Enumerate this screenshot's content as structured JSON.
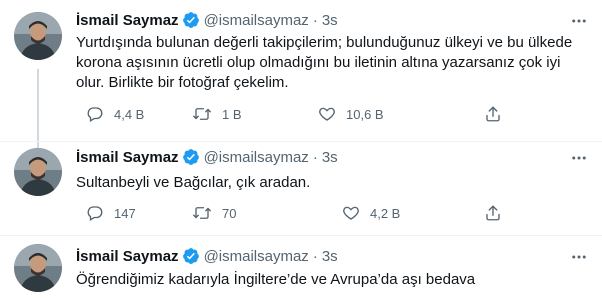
{
  "tweets": [
    {
      "name": "İsmail Saymaz",
      "handle": "@ismailsaymaz",
      "time": "3s",
      "text": "Yurtdışında bulunan değerli takipçilerim; bulunduğunuz ülkeyi ve bu ülkede korona aşısının ücretli olup olmadığını bu iletinin altına yazarsanız çok iyi olur. Birlikte bir fotoğraf çekelim.",
      "replies": "4,4 B",
      "retweets": "1 B",
      "likes": "10,6 B"
    },
    {
      "name": "İsmail Saymaz",
      "handle": "@ismailsaymaz",
      "time": "3s",
      "text": "Sultanbeyli ve Bağcılar, çık aradan.",
      "replies": "147",
      "retweets": "70",
      "likes": "4,2 B"
    },
    {
      "name": "İsmail Saymaz",
      "handle": "@ismailsaymaz",
      "time": "3s",
      "text": "Öğrendiğimiz kadarıyla İngiltere’de ve Avrupa’da aşı bedava"
    }
  ],
  "colors": {
    "text": "#0f1419",
    "secondary": "#536471",
    "verified": "#1d9bf0",
    "divider": "#eff3f4",
    "thread_line": "#cfd9de"
  },
  "icons": [
    "verified-badge-icon",
    "more-icon",
    "reply-icon",
    "retweet-icon",
    "like-icon",
    "share-icon"
  ]
}
